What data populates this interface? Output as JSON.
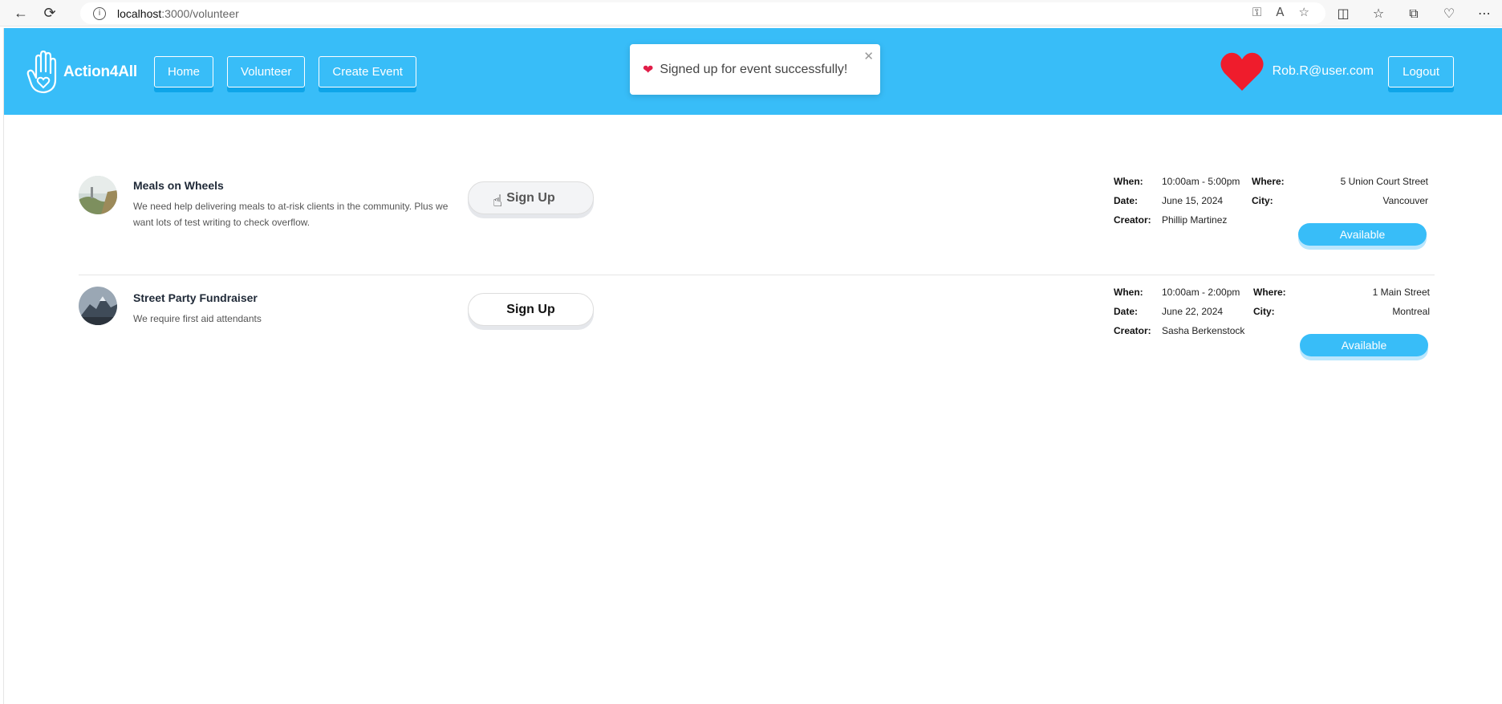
{
  "browser": {
    "url_host": "localhost",
    "url_path": ":3000/volunteer"
  },
  "app": {
    "brand": "Action4All",
    "nav": [
      "Home",
      "Volunteer",
      "Create Event"
    ],
    "toast": "Signed up for event successfully!",
    "user_email": "Rob.R@user.com",
    "logout_label": "Logout",
    "accent_color": "#38bdf8"
  },
  "events": [
    {
      "title": "Meals on Wheels",
      "description": "We need help delivering meals to at-risk clients in the community. Plus we want lots of test writing to check overflow.",
      "signup_label": "Sign Up",
      "when": "10:00am - 5:00pm",
      "date": "June 15, 2024",
      "creator": "Phillip Martinez",
      "where": "5 Union Court Street",
      "city": "Vancouver",
      "status": "Available"
    },
    {
      "title": "Street Party Fundraiser",
      "description": "We require first aid attendants",
      "signup_label": "Sign Up",
      "when": "10:00am - 2:00pm",
      "date": "June 22, 2024",
      "creator": "Sasha Berkenstock",
      "where": "1 Main Street",
      "city": "Montreal",
      "status": "Available"
    }
  ],
  "labels": {
    "when": "When:",
    "date": "Date:",
    "creator": "Creator:",
    "where": "Where:",
    "city": "City:"
  }
}
